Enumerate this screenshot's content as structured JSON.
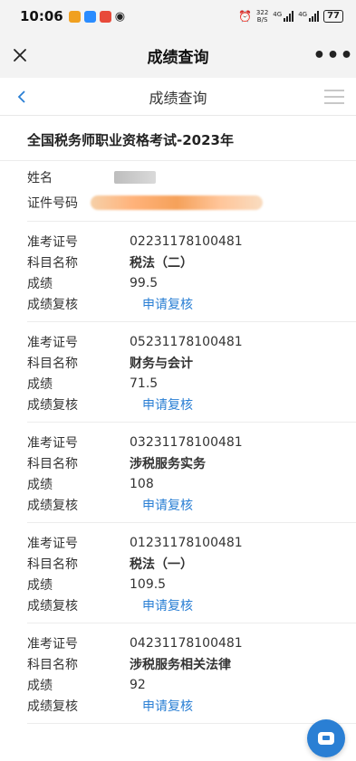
{
  "status_bar": {
    "time": "10:06",
    "net_speed_value": "322",
    "net_speed_unit": "B/S",
    "signal_1": "4G",
    "signal_2": "4G",
    "battery": "77"
  },
  "title_bar": {
    "title": "成绩查询",
    "close_icon": "close-icon",
    "more_icon": "more-icon",
    "more_text": "•••"
  },
  "page_header": {
    "title": "成绩查询",
    "back_icon": "chevron-left-icon",
    "menu_icon": "hamburger-menu-icon"
  },
  "exam": {
    "title": "全国税务师职业资格考试-2023年",
    "name_label": "姓名",
    "id_label": "证件号码"
  },
  "labels": {
    "ticket": "准考证号",
    "subject": "科目名称",
    "score": "成绩",
    "review": "成绩复核"
  },
  "results": [
    {
      "ticket": "02231178100481",
      "subject": "税法（二）",
      "score": "99.5",
      "review_link": "申请复核"
    },
    {
      "ticket": "05231178100481",
      "subject": "财务与会计",
      "score": "71.5",
      "review_link": "申请复核"
    },
    {
      "ticket": "03231178100481",
      "subject": "涉税服务实务",
      "score": "108",
      "review_link": "申请复核"
    },
    {
      "ticket": "01231178100481",
      "subject": "税法（一）",
      "score": "109.5",
      "review_link": "申请复核"
    },
    {
      "ticket": "04231178100481",
      "subject": "涉税服务相关法律",
      "score": "92",
      "review_link": "申请复核"
    }
  ],
  "colors": {
    "accent": "#2a7fd4",
    "bar_background": "#f3f3f3"
  }
}
